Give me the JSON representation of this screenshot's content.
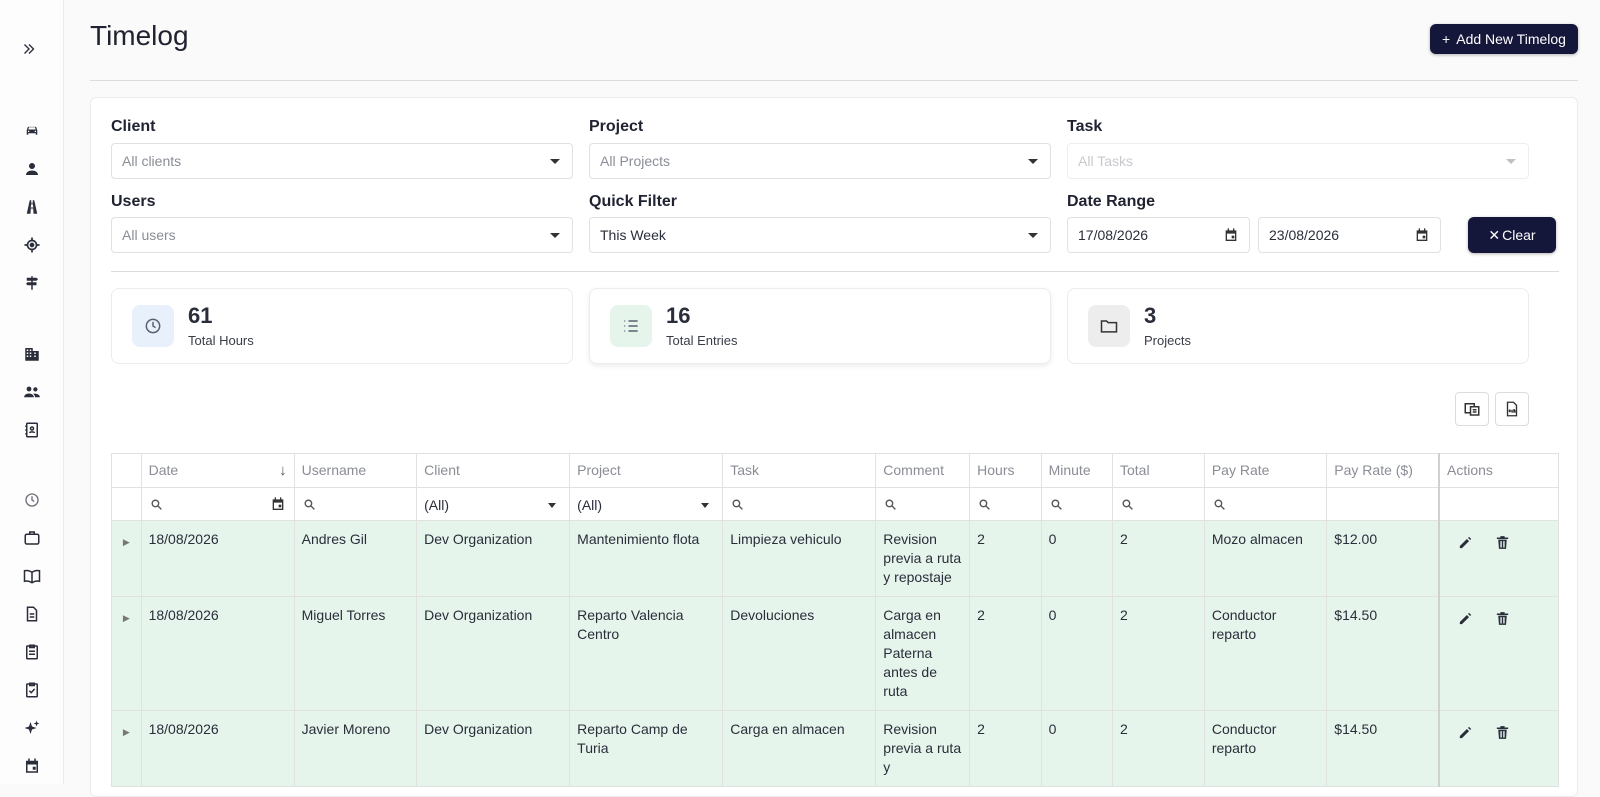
{
  "page": {
    "title": "Timelog",
    "add_button_label": "Add New Timelog"
  },
  "sidebar": {
    "toggle_icon": "double-chevron-right-icon",
    "items": [
      {
        "icon": "car-icon"
      },
      {
        "icon": "person-icon"
      },
      {
        "icon": "road-icon"
      },
      {
        "icon": "target-icon"
      },
      {
        "icon": "signpost-icon"
      },
      {
        "icon": "building-icon"
      },
      {
        "icon": "group-icon"
      },
      {
        "icon": "contacts-book-icon"
      },
      {
        "icon": "clock-icon"
      },
      {
        "icon": "briefcase-icon"
      },
      {
        "icon": "open-book-icon"
      },
      {
        "icon": "document-icon"
      },
      {
        "icon": "clipboard-icon"
      },
      {
        "icon": "clipboard-check-icon"
      },
      {
        "icon": "sparkle-icon"
      },
      {
        "icon": "calendar-icon"
      }
    ]
  },
  "filters": {
    "client": {
      "label": "Client",
      "placeholder": "All clients"
    },
    "project": {
      "label": "Project",
      "placeholder": "All Projects"
    },
    "task": {
      "label": "Task",
      "placeholder": "All Tasks"
    },
    "users": {
      "label": "Users",
      "placeholder": "All users"
    },
    "quick_filter": {
      "label": "Quick Filter",
      "value": "This Week"
    },
    "date_range": {
      "label": "Date Range",
      "start": "17/08/2026",
      "end": "23/08/2026"
    },
    "clear_label": "Clear"
  },
  "stats": [
    {
      "value": "61",
      "label": "Total Hours",
      "icon": "clock-icon",
      "bg": "#e8f0fc"
    },
    {
      "value": "16",
      "label": "Total Entries",
      "icon": "list-icon",
      "bg": "#e6f5ec"
    },
    {
      "value": "3",
      "label": "Projects",
      "icon": "folder-icon",
      "bg": "#ededed"
    }
  ],
  "table": {
    "columns": [
      "Date",
      "Username",
      "Client",
      "Project",
      "Task",
      "Comment",
      "Hours",
      "Minute",
      "Total",
      "Pay Rate",
      "Pay Rate ($)",
      "Actions"
    ],
    "filter_selects": {
      "client": "(All)",
      "project": "(All)"
    },
    "rows": [
      {
        "date": "18/08/2026",
        "username": "Andres Gil",
        "client": "Dev Organization",
        "project": "Mantenimiento flota",
        "task": "Limpieza vehiculo",
        "comment": "Revision previa a ruta y repostaje",
        "hours": "2",
        "minute": "0",
        "total": "2",
        "pay_rate": "Mozo almacen",
        "pay_rate_usd": "$12.00"
      },
      {
        "date": "18/08/2026",
        "username": "Miguel Torres",
        "client": "Dev Organization",
        "project": "Reparto Valencia Centro",
        "task": "Devoluciones",
        "comment": "Carga en almacen Paterna antes de ruta",
        "hours": "2",
        "minute": "0",
        "total": "2",
        "pay_rate": "Conductor reparto",
        "pay_rate_usd": "$14.50"
      },
      {
        "date": "18/08/2026",
        "username": "Javier Moreno",
        "client": "Dev Organization",
        "project": "Reparto Camp de Turia",
        "task": "Carga en almacen",
        "comment": "Revision previa a ruta y",
        "hours": "2",
        "minute": "0",
        "total": "2",
        "pay_rate": "Conductor reparto",
        "pay_rate_usd": "$14.50"
      }
    ]
  },
  "colors": {
    "primary": "#14163a",
    "row_highlight": "#e6f5ec"
  }
}
